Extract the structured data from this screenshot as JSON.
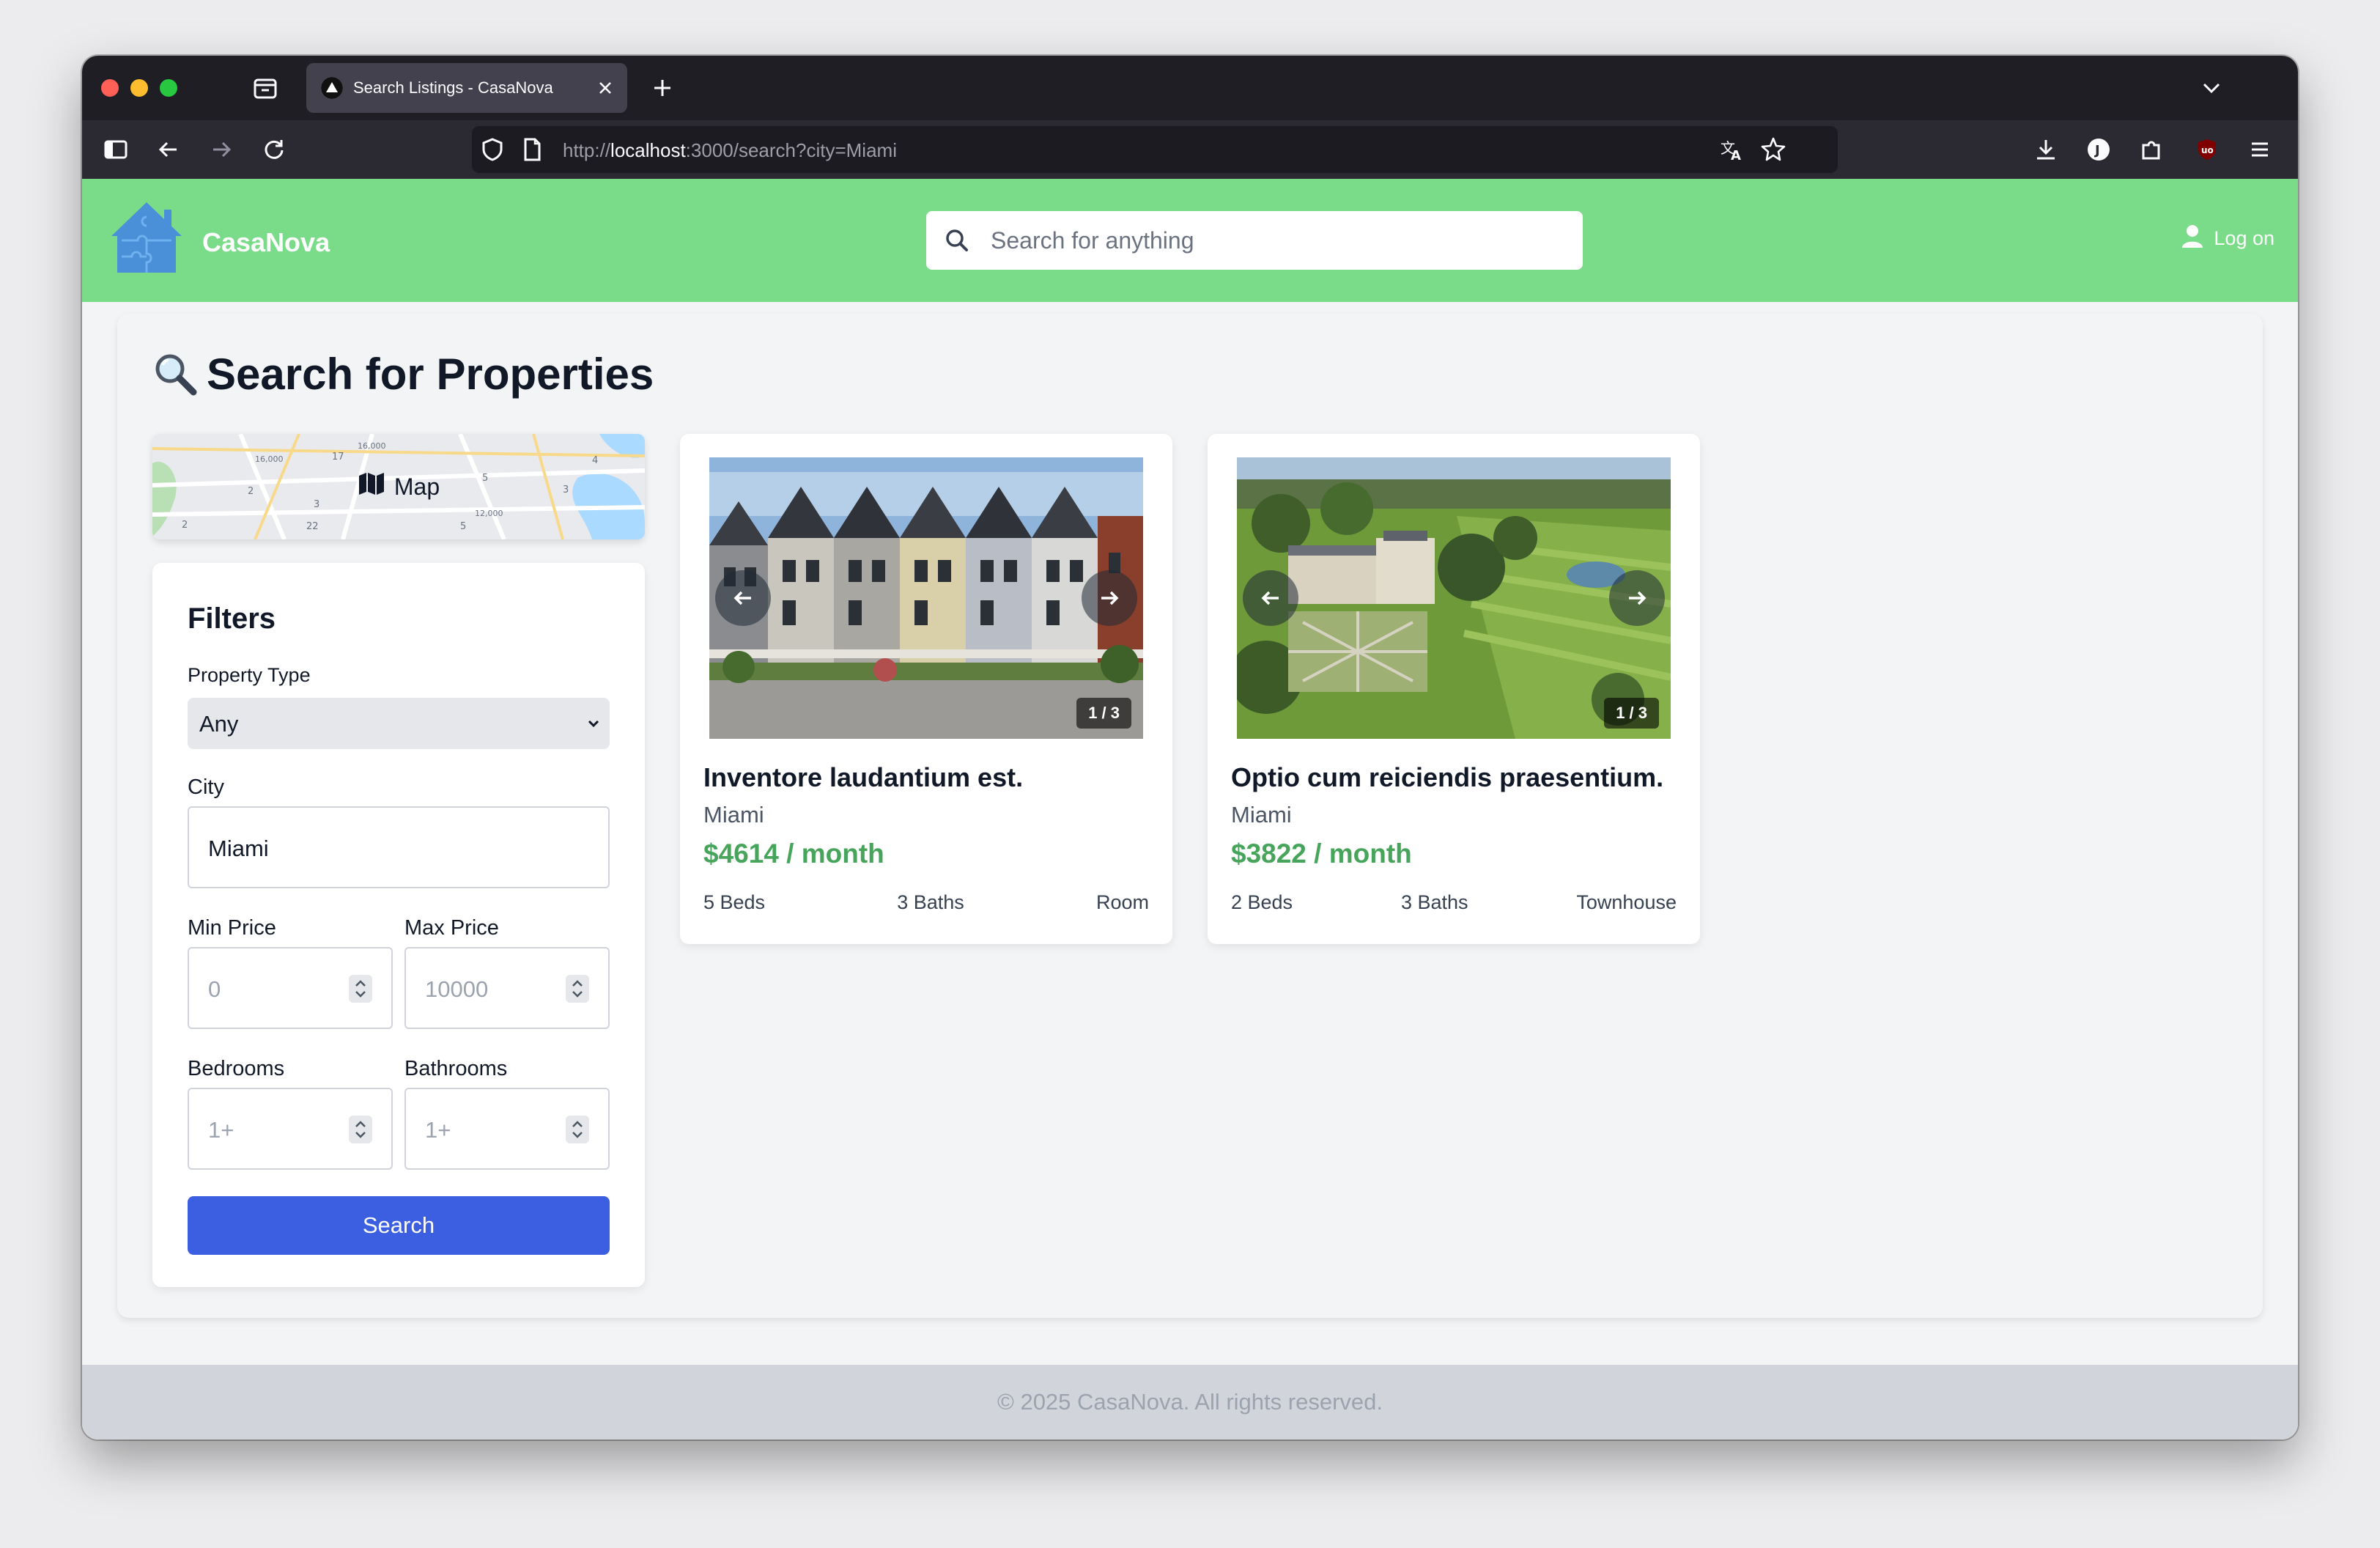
{
  "browser": {
    "tab_title": "Search Listings - CasaNova",
    "url_scheme": "http://",
    "url_host": "localhost",
    "url_rest": ":3000/search?city=Miami"
  },
  "header": {
    "brand": "CasaNova",
    "search_placeholder": "Search for anything",
    "login_label": "Log on"
  },
  "page": {
    "title": "Search for Properties",
    "map_label": "Map"
  },
  "filters": {
    "title": "Filters",
    "property_type_label": "Property Type",
    "property_type_value": "Any",
    "city_label": "City",
    "city_value": "Miami",
    "min_price_label": "Min Price",
    "min_price_placeholder": "0",
    "max_price_label": "Max Price",
    "max_price_placeholder": "10000",
    "bedrooms_label": "Bedrooms",
    "bedrooms_placeholder": "1+",
    "bathrooms_label": "Bathrooms",
    "bathrooms_placeholder": "1+",
    "search_button": "Search"
  },
  "listings": [
    {
      "title": "Inventore laudantium est.",
      "city": "Miami",
      "price": "$4614 / month",
      "beds": "5 Beds",
      "baths": "3 Baths",
      "type": "Room",
      "image_counter": "1 / 3"
    },
    {
      "title": "Optio cum reiciendis praesentium.",
      "city": "Miami",
      "price": "$3822 / month",
      "beds": "2 Beds",
      "baths": "3 Baths",
      "type": "Townhouse",
      "image_counter": "1 / 3"
    }
  ],
  "footer": {
    "text": "© 2025 CasaNova. All rights reserved."
  },
  "colors": {
    "header_bg": "#7adb88",
    "primary_button": "#3b5fe0",
    "price_green": "#47a55b"
  }
}
